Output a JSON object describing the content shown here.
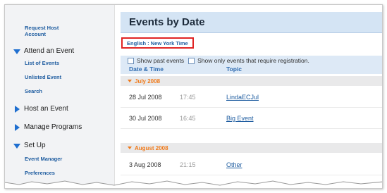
{
  "sidebar": {
    "request_host_account": [
      "Request Host",
      "Account"
    ],
    "attend_event": {
      "label": "Attend an Event",
      "items": [
        "List of Events",
        "Unlisted Event",
        "Search"
      ]
    },
    "host_event": {
      "label": "Host an Event"
    },
    "manage_programs": {
      "label": "Manage Programs"
    },
    "set_up": {
      "label": "Set Up",
      "items": [
        "Event Manager",
        "Preferences"
      ]
    }
  },
  "main": {
    "title": "Events by Date",
    "locale_text": "English : New York Time",
    "filters": {
      "show_past": "Show past events",
      "show_registration": "Show only events that require registration."
    },
    "columns": {
      "date_time": "Date & Time",
      "topic": "Topic"
    },
    "months": [
      {
        "label": "July 2008",
        "events": [
          {
            "date": "28  Jul 2008",
            "time": "17:45",
            "topic": "LindaECJul"
          },
          {
            "date": "30  Jul 2008",
            "time": "16:45",
            "topic": "Big Event"
          }
        ]
      },
      {
        "label": "August 2008",
        "events": [
          {
            "date": "3  Aug 2008",
            "time": "21:15",
            "topic": "Other"
          }
        ]
      }
    ]
  },
  "colors": {
    "accent_blue": "#1f5da0",
    "title_bar": "#d4e4f4",
    "month_orange": "#f07a1a",
    "highlight_red": "#e02424"
  }
}
